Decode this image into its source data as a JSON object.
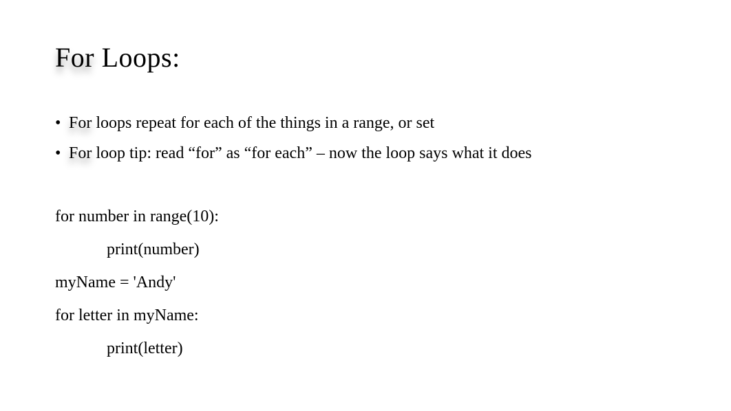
{
  "title": {
    "for_word": "For",
    "rest": "  Loops:"
  },
  "bullets": [
    {
      "for_word": "For",
      "rest_before": " loops",
      "rest_after": " repeat for each of the things in a range, or set"
    },
    {
      "for_word": "For",
      "rest_before": " loop tip: read “for” as “for each” – now the loop says what it does",
      "rest_after": ""
    }
  ],
  "code": {
    "line1": "for number in range(10):",
    "line2": "print(number)",
    "line3": "myName = 'Andy'",
    "line4": "for letter in myName:",
    "line5": "print(letter)"
  }
}
